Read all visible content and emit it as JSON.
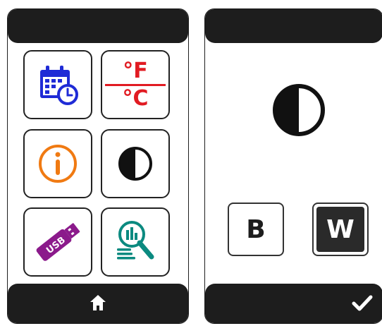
{
  "menu": {
    "tiles": [
      {
        "icon": "calendar-clock-icon",
        "color": "#1f2bd6"
      },
      {
        "icon": "temperature-unit-icon",
        "top_label": "°F",
        "bottom_label": "°C",
        "color": "#e11b22"
      },
      {
        "icon": "info-icon",
        "color": "#f07a12"
      },
      {
        "icon": "contrast-icon",
        "color": "#111111"
      },
      {
        "icon": "usb-stick-icon",
        "label": "USB",
        "color": "#8b1a8b"
      },
      {
        "icon": "data-search-icon",
        "color": "#0b8a80"
      }
    ],
    "nav": {
      "icon": "home-icon"
    }
  },
  "contrast_screen": {
    "icon": "contrast-icon",
    "options": [
      {
        "label": "B",
        "selected": false
      },
      {
        "label": "W",
        "selected": true
      }
    ],
    "nav": {
      "icon": "checkmark-icon"
    }
  }
}
